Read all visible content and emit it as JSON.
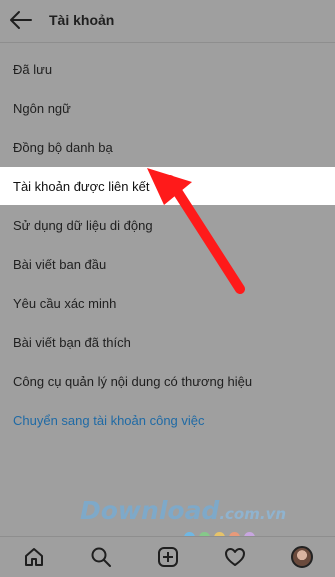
{
  "header": {
    "title": "Tài khoản",
    "back_icon": "back-arrow-icon"
  },
  "menu": {
    "items": [
      {
        "label": "Đã lưu"
      },
      {
        "label": "Ngôn ngữ"
      },
      {
        "label": "Đồng bộ danh bạ"
      },
      {
        "label": "Tài khoản được liên kết"
      },
      {
        "label": "Sử dụng dữ liệu di động"
      },
      {
        "label": "Bài viết ban đầu"
      },
      {
        "label": "Yêu cầu xác minh"
      },
      {
        "label": "Bài viết bạn đã thích"
      },
      {
        "label": "Công cụ quản lý nội dung có thương hiệu"
      },
      {
        "label": "Chuyển sang tài khoản công việc"
      }
    ],
    "highlighted_item": "Tài khoản được liên kết",
    "link_color": "#1f6aa5"
  },
  "watermark": {
    "text": "Download",
    "suffix": ".com.vn"
  },
  "annotation": {
    "arrow_color": "#ff1a1a"
  },
  "bottom_nav": {
    "icons": [
      "home-icon",
      "search-icon",
      "add-post-icon",
      "heart-icon",
      "profile-avatar"
    ]
  }
}
